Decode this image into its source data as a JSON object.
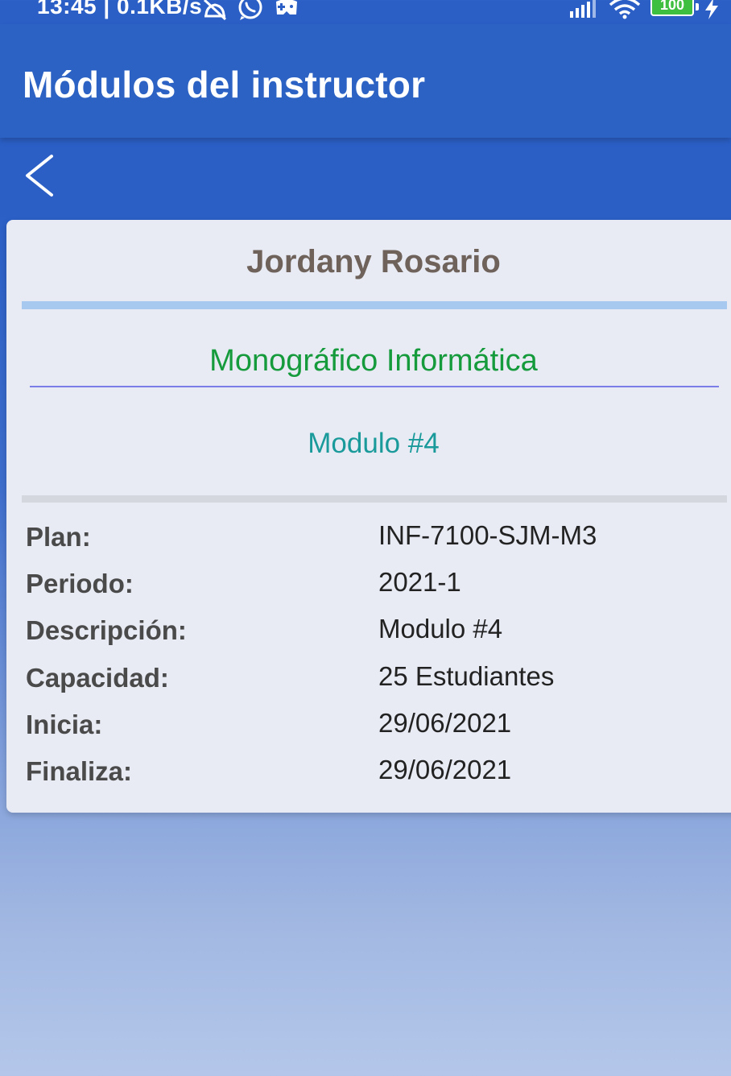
{
  "status_bar": {
    "time": "13:45 | 0.1KB/s",
    "battery": "100",
    "icons": [
      "alarm-off-icon",
      "whatsapp-icon",
      "game-controller-icon",
      "signal-icon",
      "wifi-icon",
      "battery-icon",
      "charging-icon"
    ]
  },
  "app_bar": {
    "title": "Módulos del instructor"
  },
  "nav": {
    "back_icon": "chevron-left-icon"
  },
  "card": {
    "instructor_name": "Jordany Rosario",
    "program": "Monográfico Informática",
    "module": "Modulo #4",
    "details": [
      {
        "label": "Plan:",
        "value": "INF-7100-SJM-M3"
      },
      {
        "label": "Periodo:",
        "value": "2021-1"
      },
      {
        "label": "Descripción:",
        "value": "Modulo #4"
      },
      {
        "label": "Capacidad:",
        "value": "25 Estudiantes"
      },
      {
        "label": "Inicia:",
        "value": "29/06/2021"
      },
      {
        "label": "Finaliza:",
        "value": "29/06/2021"
      }
    ]
  },
  "colors": {
    "app_bar": "#2b62c4",
    "name_text": "#6e625b",
    "program_text": "#159a3c",
    "module_text": "#1a9a9a",
    "blue_divider": "#a8c9ef",
    "card_background": "#e8ebf4"
  }
}
